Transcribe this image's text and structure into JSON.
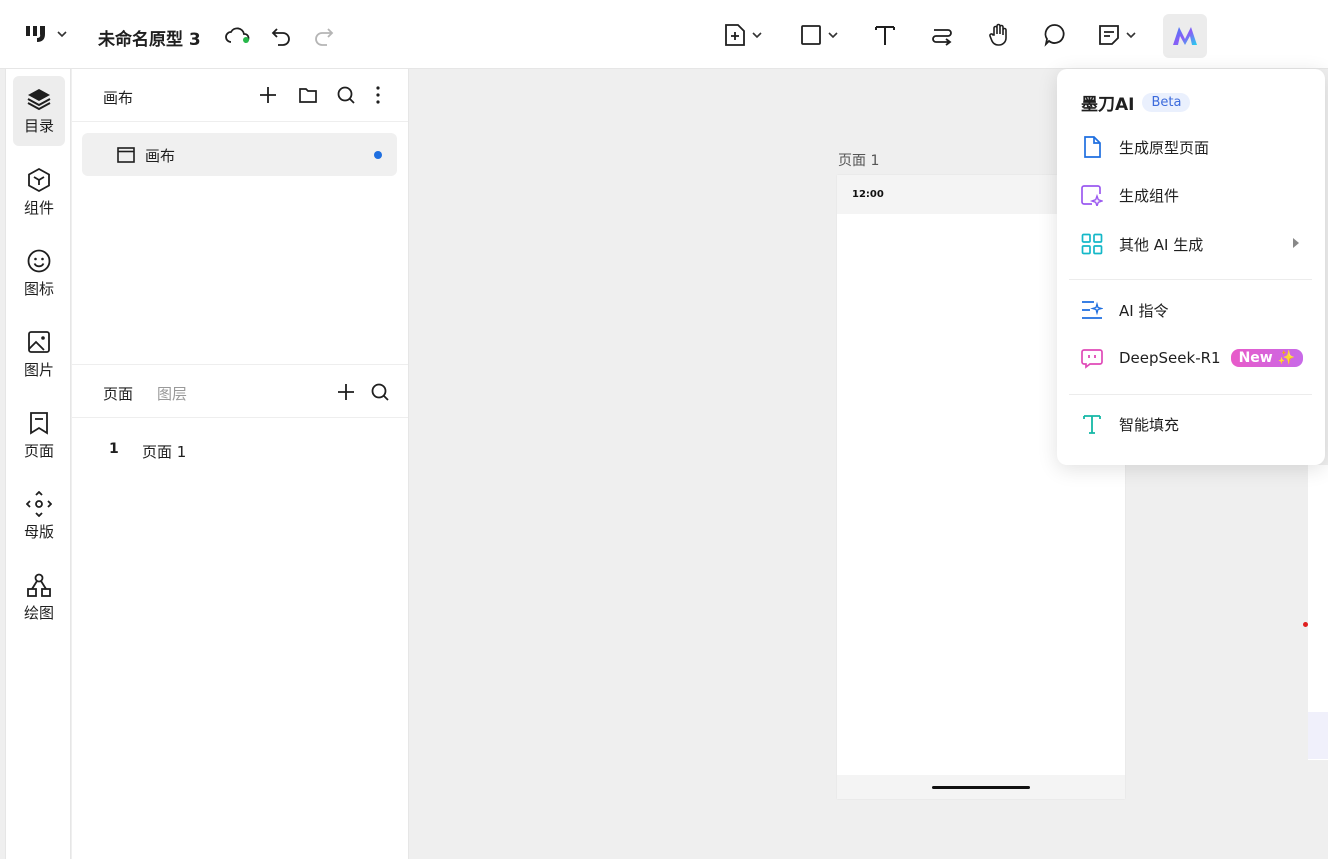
{
  "topbar": {
    "title": "未命名原型 3",
    "tools": [
      "add-page-icon",
      "rectangle-icon",
      "text-icon",
      "connector-icon",
      "hand-icon",
      "comment-icon",
      "note-icon",
      "ai-logo-icon"
    ]
  },
  "rail": {
    "items": [
      {
        "label": "目录",
        "icon": "layers-icon",
        "active": true
      },
      {
        "label": "组件",
        "icon": "component-icon"
      },
      {
        "label": "图标",
        "icon": "smile-icon"
      },
      {
        "label": "图片",
        "icon": "image-icon"
      },
      {
        "label": "页面",
        "icon": "page-icon"
      },
      {
        "label": "母版",
        "icon": "master-icon"
      },
      {
        "label": "绘图",
        "icon": "diagram-icon"
      }
    ]
  },
  "panel": {
    "header_label": "画布",
    "canvas_item": "画布",
    "tabs": {
      "pages": "页面",
      "layers": "图层"
    },
    "pages": [
      {
        "num": "1",
        "name": "页面 1"
      }
    ]
  },
  "canvas": {
    "page_label": "页面 1",
    "status_time": "12:00"
  },
  "ai_menu": {
    "title": "墨刀AI",
    "badge": "Beta",
    "items": [
      {
        "label": "生成原型页面",
        "icon": "document-icon"
      },
      {
        "label": "生成组件",
        "icon": "sparkle-component-icon"
      },
      {
        "label": "其他 AI 生成",
        "icon": "grid-icon"
      },
      {
        "label": "AI 指令",
        "icon": "ai-command-icon"
      },
      {
        "label": "DeepSeek-R1",
        "icon": "chat-bot-icon",
        "badge": "New ✨"
      },
      {
        "label": "智能填充",
        "icon": "text-fill-icon"
      }
    ]
  },
  "colors": {
    "accent": "#1f6fe0",
    "ai_purple": "#9b59f0",
    "ai_teal": "#14b8c8",
    "new_badge": "#e85ac9"
  }
}
